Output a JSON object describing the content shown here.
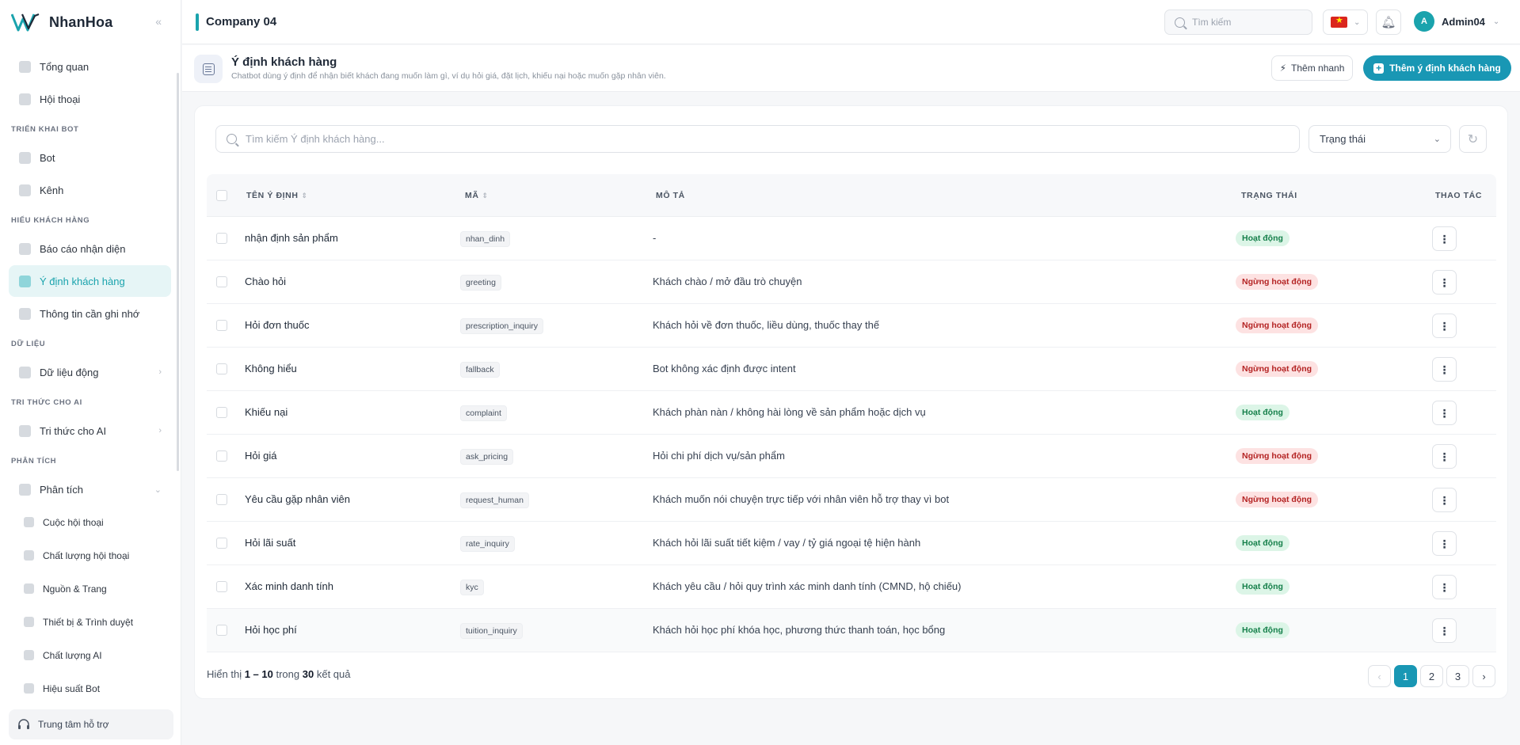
{
  "app": {
    "brand": "NhanHoa",
    "company": "Company 04"
  },
  "sidebar": {
    "top_items": [
      {
        "label": "Tổng quan",
        "icon": "dashboard-icon"
      },
      {
        "label": "Hội thoại",
        "icon": "chat-icon"
      }
    ],
    "sections": [
      {
        "label": "TRIỂN KHAI BOT",
        "items": [
          {
            "label": "Bot"
          },
          {
            "label": "Kênh"
          }
        ]
      },
      {
        "label": "HIỂU KHÁCH HÀNG",
        "items": [
          {
            "label": "Báo cáo nhận diện"
          },
          {
            "label": "Ý định khách hàng"
          },
          {
            "label": "Thông tin cần ghi nhớ"
          }
        ]
      },
      {
        "label": "DỮ LIỆU",
        "items": [
          {
            "label": "Dữ liệu động"
          }
        ]
      },
      {
        "label": "TRI THỨC CHO AI",
        "items": [
          {
            "label": "Tri thức cho AI"
          }
        ]
      },
      {
        "label": "PHÂN TÍCH",
        "items": [
          {
            "label": "Phân tích"
          }
        ]
      }
    ],
    "sub_items": [
      {
        "label": "Cuộc hội thoại"
      },
      {
        "label": "Chất lượng hội thoại"
      },
      {
        "label": "Nguồn & Trang"
      },
      {
        "label": "Thiết bị & Trình duyệt"
      },
      {
        "label": "Chất lượng AI"
      },
      {
        "label": "Hiệu suất Bot"
      }
    ],
    "support": "Trung tâm hỗ trợ"
  },
  "topbar": {
    "search_placeholder": "Tìm kiếm",
    "user": "Admin04",
    "avatar_letter": "A"
  },
  "page": {
    "title": "Ý định khách hàng",
    "subtitle": "Chatbot dùng ý định để nhận biết khách đang muốn làm gì, ví dụ hỏi giá, đặt lịch, khiếu nại hoặc muốn gặp nhân viên.",
    "quick_button": "Thêm nhanh",
    "add_button": "Thêm ý định khách hàng"
  },
  "filters": {
    "search_placeholder": "Tìm kiếm Ý định khách hàng...",
    "status_select": "Trạng thái"
  },
  "table": {
    "headers": {
      "name": "TÊN Ý ĐỊNH",
      "code": "MÃ",
      "desc": "MÔ TẢ",
      "status": "TRẠNG THÁI",
      "actions": "THAO TÁC"
    },
    "rows": [
      {
        "name": "nhận định sản phẩm",
        "code": "nhan_dinh",
        "desc": "-",
        "status": "Hoạt động",
        "active": true
      },
      {
        "name": "Chào hỏi",
        "code": "greeting",
        "desc": "Khách chào / mở đầu trò chuyện",
        "status": "Ngừng hoạt động",
        "active": false
      },
      {
        "name": "Hỏi đơn thuốc",
        "code": "prescription_inquiry",
        "desc": "Khách hỏi về đơn thuốc, liều dùng, thuốc thay thế",
        "status": "Ngừng hoạt động",
        "active": false
      },
      {
        "name": "Không hiểu",
        "code": "fallback",
        "desc": "Bot không xác định được intent",
        "status": "Ngừng hoạt động",
        "active": false
      },
      {
        "name": "Khiếu nại",
        "code": "complaint",
        "desc": "Khách phàn nàn / không hài lòng về sản phẩm hoặc dịch vụ",
        "status": "Hoạt động",
        "active": true
      },
      {
        "name": "Hỏi giá",
        "code": "ask_pricing",
        "desc": "Hỏi chi phí dịch vụ/sản phẩm",
        "status": "Ngừng hoạt động",
        "active": false
      },
      {
        "name": "Yêu cầu gặp nhân viên",
        "code": "request_human",
        "desc": "Khách muốn nói chuyện trực tiếp với nhân viên hỗ trợ thay vì bot",
        "status": "Ngừng hoạt động",
        "active": false
      },
      {
        "name": "Hỏi lãi suất",
        "code": "rate_inquiry",
        "desc": "Khách hỏi lãi suất tiết kiệm / vay / tỷ giá ngoại tệ hiện hành",
        "status": "Hoạt động",
        "active": true
      },
      {
        "name": "Xác minh danh tính",
        "code": "kyc",
        "desc": "Khách yêu cầu / hỏi quy trình xác minh danh tính (CMND, hộ chiếu)",
        "status": "Hoạt động",
        "active": true
      },
      {
        "name": "Hỏi học phí",
        "code": "tuition_inquiry",
        "desc": "Khách hỏi học phí khóa học, phương thức thanh toán, học bổng",
        "status": "Hoạt động",
        "active": true
      }
    ]
  },
  "footer": {
    "prefix": "Hiển thị",
    "range": "1 – 10",
    "mid": "trong",
    "total": "30",
    "suffix": "kết quả"
  },
  "pagination": {
    "pages": [
      "1",
      "2",
      "3"
    ],
    "current": "1"
  },
  "colors": {
    "accent": "#1aa3ad",
    "primary_button": "#1997b4"
  }
}
